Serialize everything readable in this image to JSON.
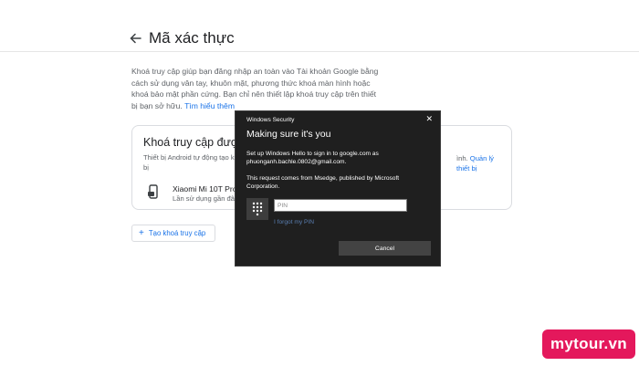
{
  "page": {
    "title": "Mã xác thực",
    "description": "Khoá truy cập giúp bạn đăng nhập an toàn vào Tài khoản Google bằng cách sử dụng vân tay, khuôn mặt, phương thức khoá màn hình hoặc khoá bảo mật phần cứng. Bạn chỉ nên thiết lập khoá truy cập trên thiết bị bạn sở hữu. ",
    "learn_more": "Tìm hiểu thêm"
  },
  "card": {
    "title": "Khoá truy cập được",
    "subtitle": "Thiết bị Android tự động tạo kh",
    "subtitle_end": "ình.",
    "subtitle_line2": "bị",
    "manage_link": "Quản lý thiết bị",
    "device": {
      "name": "Xiaomi Mi 10T Pro",
      "last_used": "Lần sử dụng gần đây"
    }
  },
  "create_button": {
    "label": "Tạo khoá truy cập"
  },
  "dialog": {
    "header": "Windows Security",
    "title": "Making sure it's you",
    "text1": "Set up Windows Hello to sign in to google.com as phuonganh.bachle.0802@gmail.com.",
    "text2": "This request comes from Msedge, published by Microsoft Corporation.",
    "pin_placeholder": "PIN",
    "forgot_pin": "I forgot my PIN",
    "cancel_label": "Cancel"
  },
  "brand": {
    "text": "mytour.vn",
    "color": "#e4185c"
  }
}
